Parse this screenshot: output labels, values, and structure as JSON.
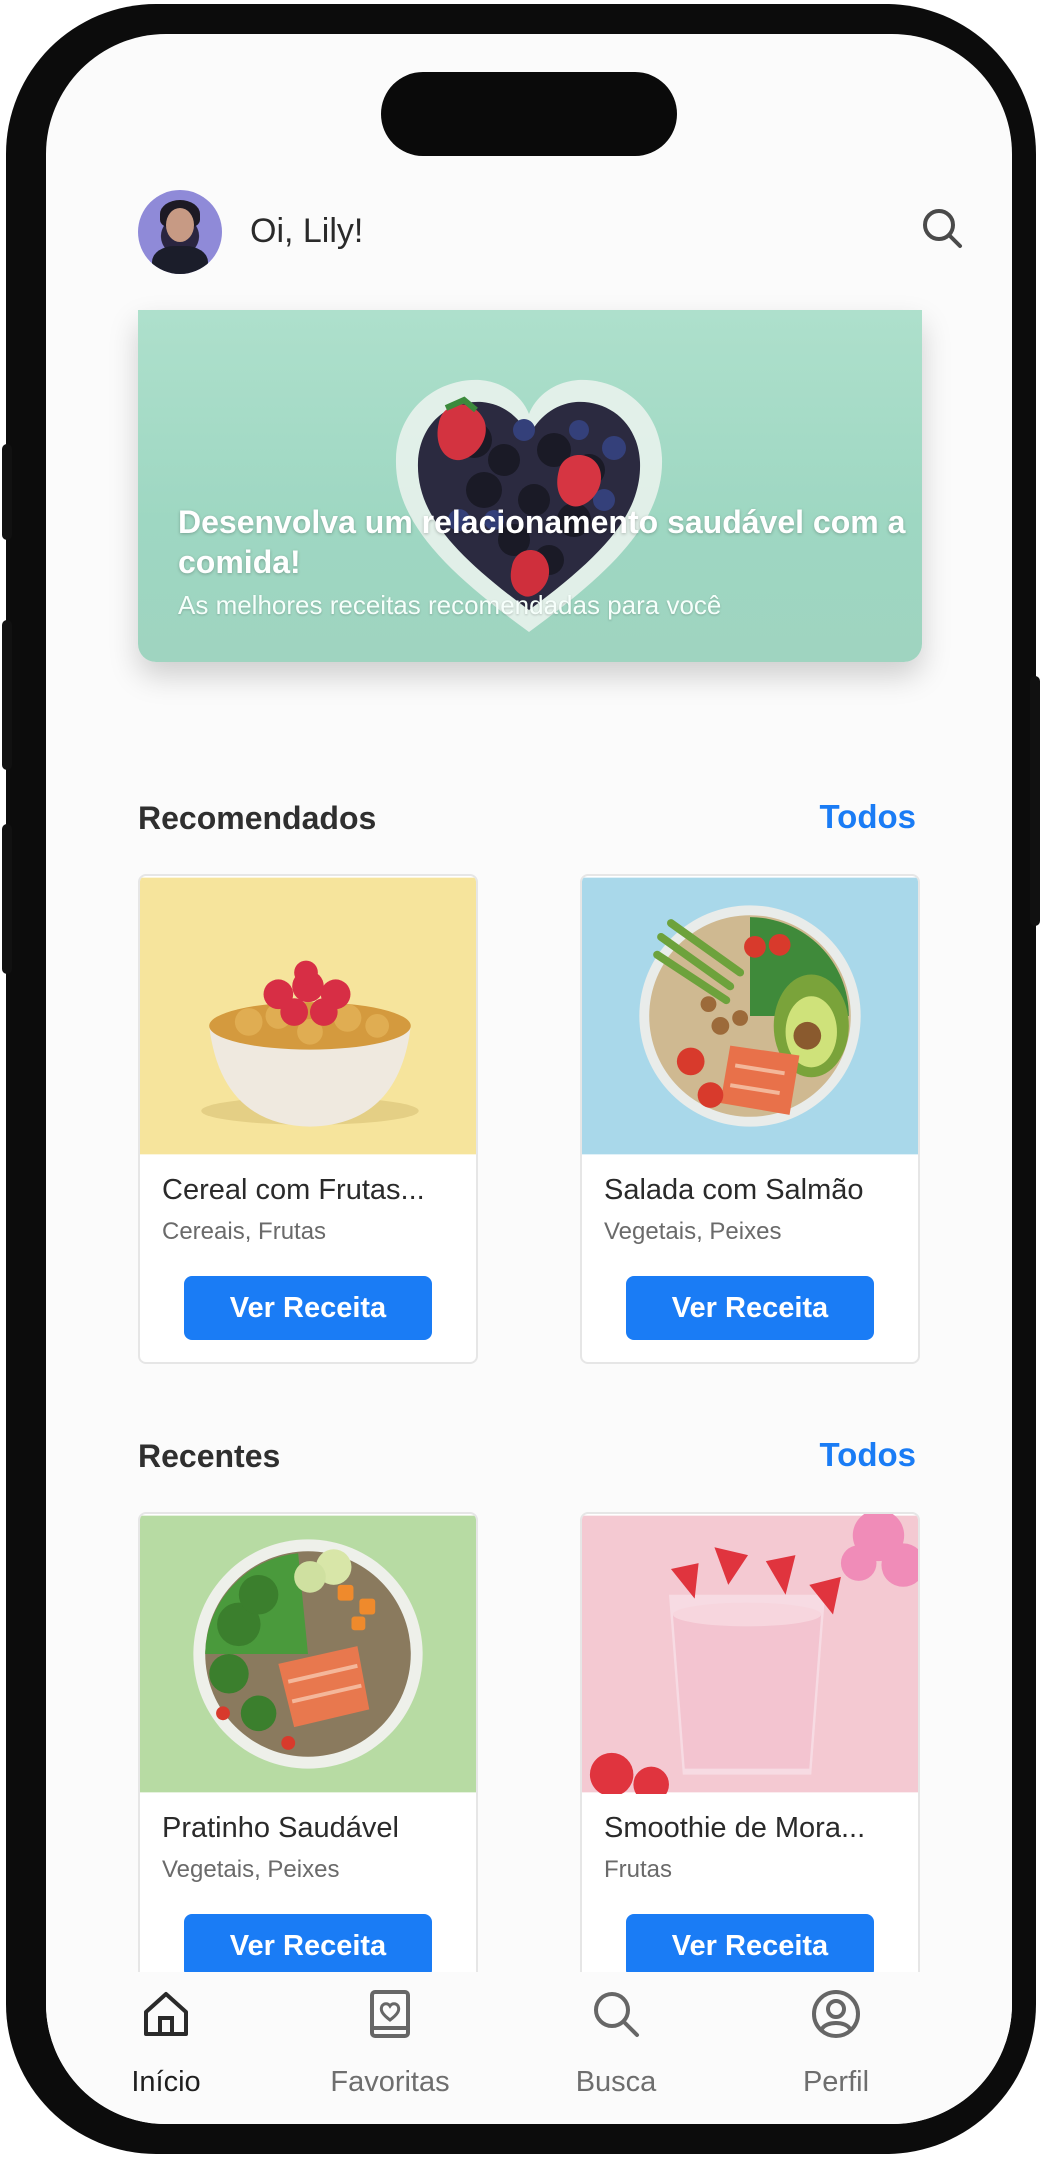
{
  "header": {
    "greeting": "Oi, Lily!"
  },
  "banner": {
    "title": "Desenvolva um relacionamento saudável com a comida!",
    "subtitle": "As melhores receitas recomendadas para você"
  },
  "sections": {
    "recommended": {
      "title": "Recomendados",
      "link": "Todos",
      "cards": [
        {
          "name": "Cereal com Frutas...",
          "tags": "Cereais, Frutas",
          "button": "Ver Receita"
        },
        {
          "name": "Salada com Salmão",
          "tags": "Vegetais, Peixes",
          "button": "Ver Receita"
        }
      ]
    },
    "recent": {
      "title": "Recentes",
      "link": "Todos",
      "cards": [
        {
          "name": "Pratinho Saudável",
          "tags": "Vegetais, Peixes",
          "button": "Ver Receita"
        },
        {
          "name": "Smoothie de Mora...",
          "tags": "Frutas",
          "button": "Ver Receita"
        }
      ]
    }
  },
  "tabbar": {
    "items": [
      {
        "label": "Início",
        "icon": "home-icon",
        "active": true
      },
      {
        "label": "Favoritas",
        "icon": "favorites-book-icon",
        "active": false
      },
      {
        "label": "Busca",
        "icon": "search-icon",
        "active": false
      },
      {
        "label": "Perfil",
        "icon": "profile-icon",
        "active": false
      }
    ]
  },
  "colors": {
    "accent": "#1a7cf5",
    "banner_bg": "#a6dcc7",
    "text": "#2f2f2f"
  }
}
